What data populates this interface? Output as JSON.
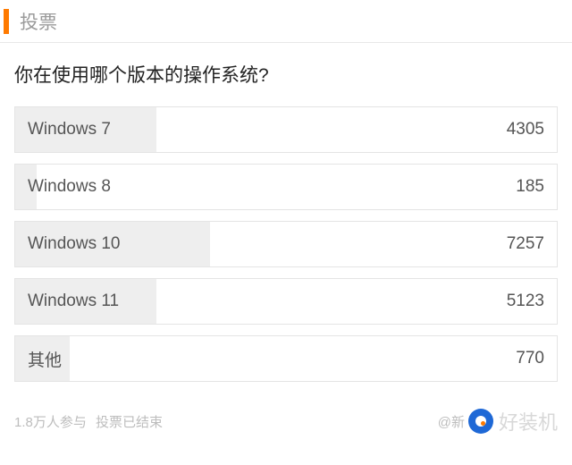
{
  "header": {
    "title": "投票"
  },
  "question": "你在使用哪个版本的操作系统?",
  "chart_data": {
    "type": "bar",
    "title": "你在使用哪个版本的操作系统?",
    "categories": [
      "Windows 7",
      "Windows 8",
      "Windows 10",
      "Windows 11",
      "其他"
    ],
    "values": [
      4305,
      185,
      7257,
      5123,
      770
    ],
    "xlabel": "",
    "ylabel": "",
    "max_value": 7257
  },
  "options": [
    {
      "label": "Windows 7",
      "count": "4305",
      "fill_pct": 26
    },
    {
      "label": "Windows 8",
      "count": "185",
      "fill_pct": 4
    },
    {
      "label": "Windows 10",
      "count": "7257",
      "fill_pct": 36
    },
    {
      "label": "Windows 11",
      "count": "5123",
      "fill_pct": 26
    },
    {
      "label": "其他",
      "count": "770",
      "fill_pct": 10
    }
  ],
  "footer": {
    "participants": "1.8万人参与",
    "status": "投票已结束",
    "source_prefix": "@新",
    "watermark": "好装机"
  }
}
